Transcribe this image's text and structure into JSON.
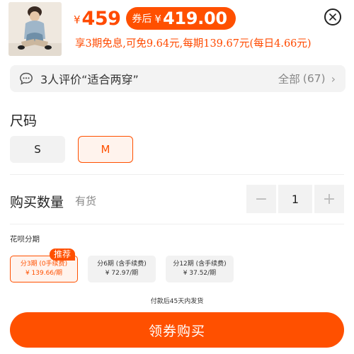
{
  "header": {
    "currency_symbol": "¥",
    "price": "459",
    "coupon_label": "券后",
    "coupon_currency": "¥",
    "coupon_price": "419.00",
    "installment_info": "享3期免息,可免9.64元,每期139.67元(每日4.66元)",
    "close_icon": "close-circle-icon"
  },
  "review": {
    "icon": "chat-bubble-icon",
    "text": "3人评价“适合两穿”",
    "all_label": "全部",
    "count": "(67)",
    "chevron": "›"
  },
  "size": {
    "title": "尺码",
    "options": [
      "S",
      "M"
    ],
    "selected": "M"
  },
  "quantity": {
    "title": "购买数量",
    "stock": "有货",
    "minus": "−",
    "value": "1",
    "plus": "+"
  },
  "huabei": {
    "title": "花呗分期",
    "recommend_tag": "推荐",
    "options": [
      {
        "line1": "分3期 (0手续费)",
        "line2": "¥ 139.66/期"
      },
      {
        "line1": "分6期 (含手续费)",
        "line2": "¥ 72.97/期"
      },
      {
        "line1": "分12期 (含手续费)",
        "line2": "¥ 37.52/期"
      }
    ],
    "selected_index": 0
  },
  "ship_note": "付款后45天内发货",
  "buy_button": "领券购买",
  "colors": {
    "accent": "#ff5000",
    "price": "#ff4a00"
  }
}
